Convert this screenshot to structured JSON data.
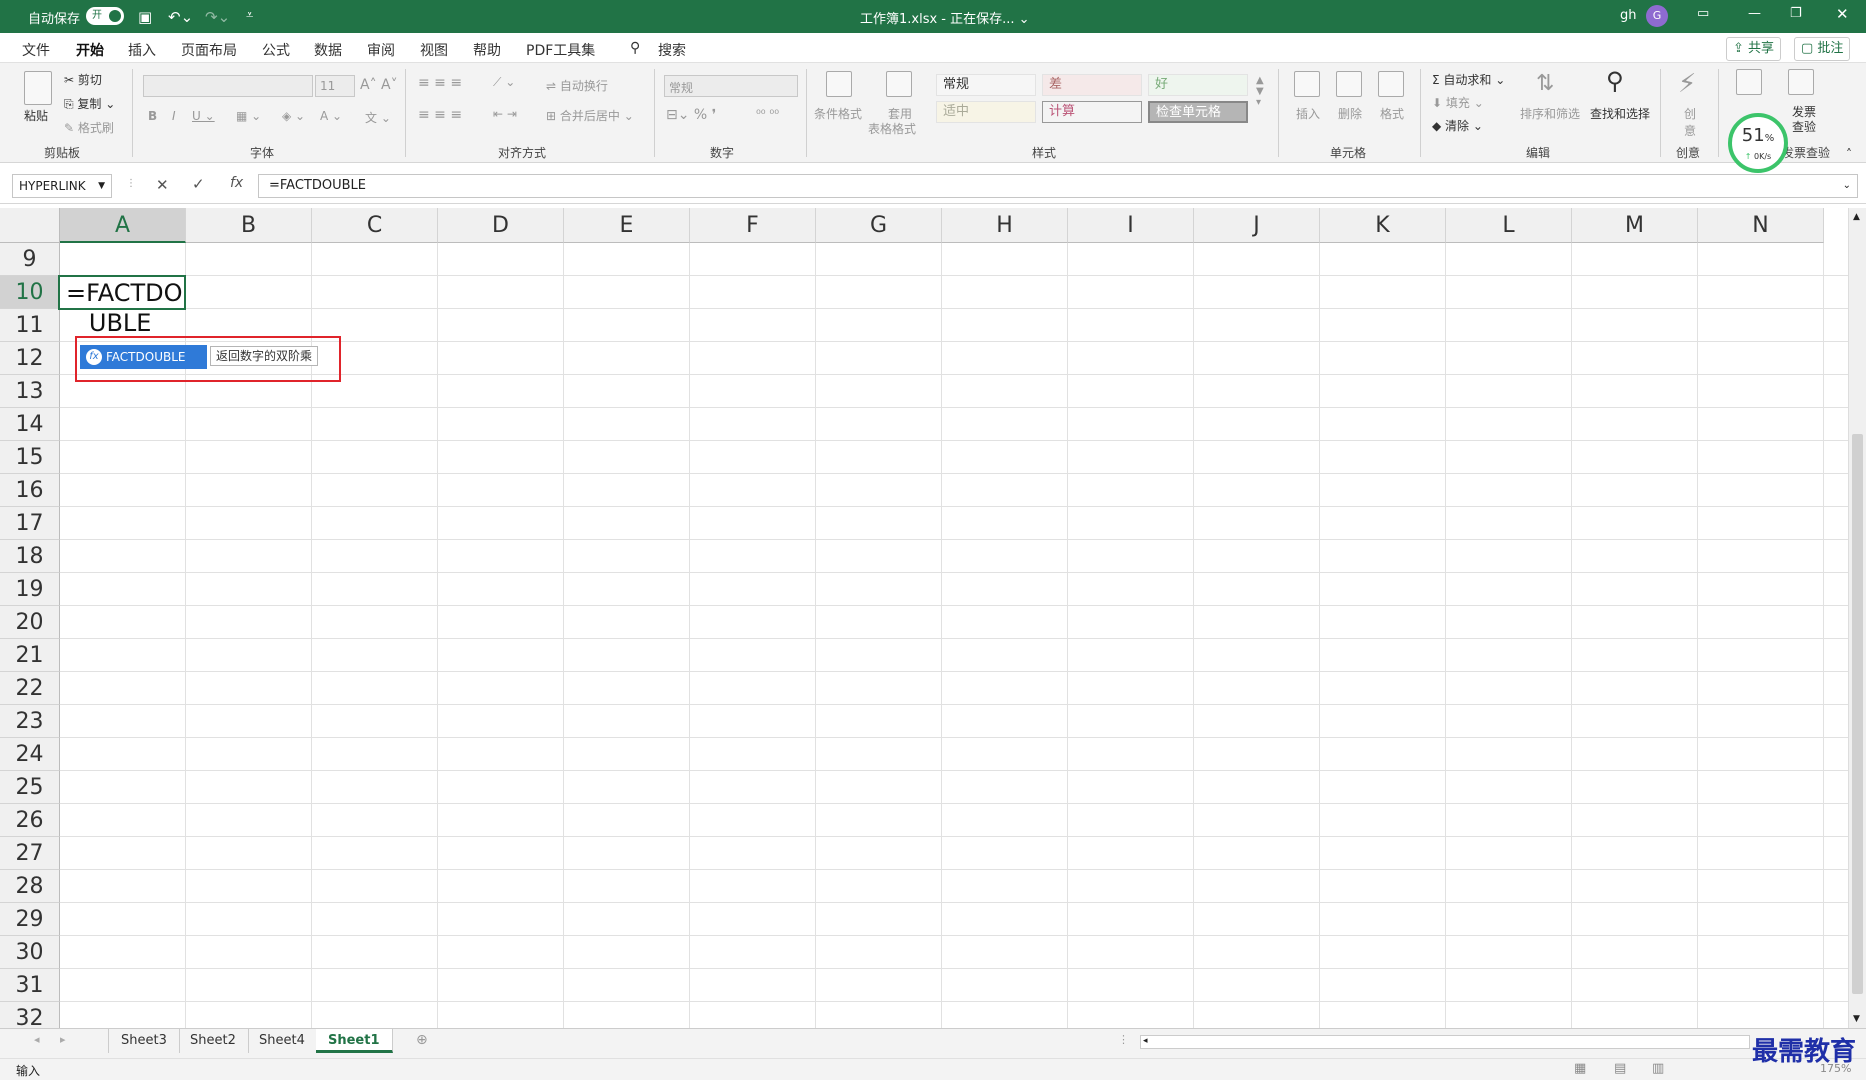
{
  "titlebar": {
    "autosave_label": "自动保存",
    "autosave_state": "开",
    "doc_title": "工作簿1.xlsx - 正在保存... ⌄",
    "user": "gh",
    "avatar_letter": "G"
  },
  "tabs": {
    "items": [
      "文件",
      "开始",
      "插入",
      "页面布局",
      "公式",
      "数据",
      "审阅",
      "视图",
      "帮助",
      "PDF工具集"
    ],
    "search": "搜索",
    "share": "共享",
    "comments": "批注"
  },
  "ribbon": {
    "paste": "粘贴",
    "cut": "剪切",
    "copy": "复制",
    "format_painter": "格式刷",
    "clipboard": "剪贴板",
    "font_size": "11",
    "font_group": "字体",
    "wrap": "自动换行",
    "merge": "合并后居中",
    "align_group": "对齐方式",
    "number_format": "常规",
    "number_group": "数字",
    "cond_format": "条件格式",
    "table_format_1": "套用",
    "table_format_2": "表格格式",
    "styles": [
      "常规",
      "差",
      "好",
      "适中",
      "计算",
      "检查单元格"
    ],
    "styles_group": "样式",
    "insert": "插入",
    "delete": "删除",
    "format": "格式",
    "cells_group": "单元格",
    "autosum": "自动求和",
    "fill": "填充",
    "clear": "清除",
    "sort_filter": "排序和筛选",
    "find_select": "查找和选择",
    "edit_group": "编辑",
    "creative": "创意",
    "creative_small": "创\n意",
    "invoice_1": "发票",
    "invoice_2": "查验",
    "invoice_group": "发票查验",
    "progress": "51",
    "progress_unit": "%",
    "progress_speed": "0K/s"
  },
  "formula_bar": {
    "name_box": "HYPERLINK",
    "formula": "=FACTDOUBLE"
  },
  "grid": {
    "columns": [
      "A",
      "B",
      "C",
      "D",
      "E",
      "F",
      "G",
      "H",
      "I",
      "J",
      "K",
      "L",
      "M",
      "N"
    ],
    "rows": [
      "9",
      "10",
      "11",
      "12",
      "13",
      "14",
      "15",
      "16",
      "17",
      "18",
      "19",
      "20",
      "21",
      "22",
      "23",
      "24",
      "25",
      "26",
      "27",
      "28",
      "29",
      "30",
      "31",
      "32"
    ],
    "active_cell_text": "=FACTDO\n   UBLE",
    "autocomplete_item": "FACTDOUBLE",
    "autocomplete_tip": "返回数字的双阶乘"
  },
  "sheets": [
    "Sheet3",
    "Sheet2",
    "Sheet4",
    "Sheet1"
  ],
  "status": {
    "mode": "输入",
    "zoom": "175%"
  },
  "watermark": "最需教育"
}
